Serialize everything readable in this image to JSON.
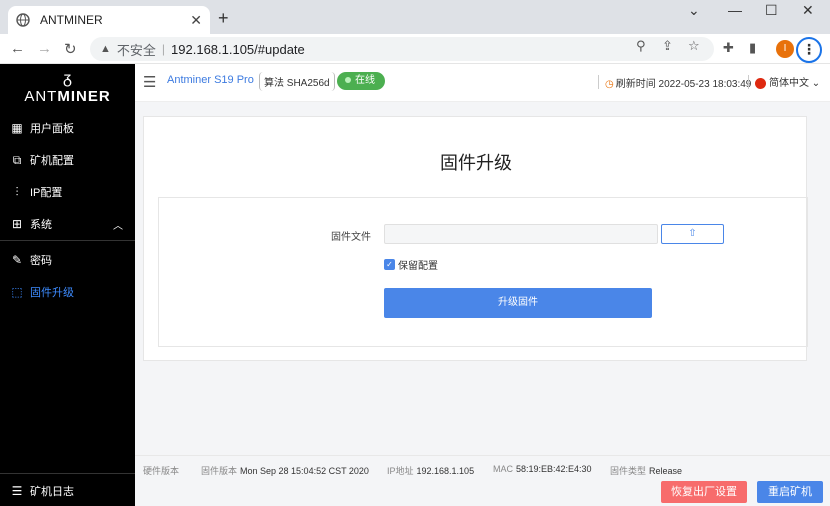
{
  "browser": {
    "tab_title": "ANTMINER",
    "new_tab_glyph": "+",
    "omnibox_security_label": "不安全",
    "url": "192.168.1.105/#update",
    "profile_initial": "I"
  },
  "sidebar": {
    "brand_left": "ANT",
    "brand_right": "MINER",
    "items": [
      {
        "label": "用户面板",
        "icon": "dashboard-icon"
      },
      {
        "label": "矿机配置",
        "icon": "config-icon"
      },
      {
        "label": "IP配置",
        "icon": "sliders-icon"
      },
      {
        "label": "系统",
        "icon": "system-icon"
      },
      {
        "label": "密码",
        "icon": "password-icon"
      },
      {
        "label": "固件升级",
        "icon": "chip-icon"
      }
    ],
    "log_label": "矿机日志"
  },
  "header": {
    "model": "Antminer S19 Pro",
    "algo_label": "算法",
    "algo_value": "SHA256d",
    "status": "在线",
    "refresh_label": "刷新时间",
    "refresh_time": "2022-05-23 18:03:49",
    "language": "简体中文"
  },
  "main": {
    "title": "固件升级",
    "file_label": "固件文件",
    "keep_config_label": "保留配置",
    "keep_config_checked": true,
    "upgrade_button": "升级固件"
  },
  "footer": {
    "hw_label": "硬件版本",
    "hw_value": "",
    "fw_label": "固件版本",
    "fw_value": "Mon Sep 28 15:04:52 CST 2020",
    "ip_label": "IP地址",
    "ip_value": "192.168.1.105",
    "mac_label": "MAC",
    "mac_value": "58:19:EB:42:E4:30",
    "fwtype_label": "固件类型",
    "fwtype_value": "Release",
    "reset_button": "恢复出厂设置",
    "reboot_button": "重启矿机"
  },
  "colors": {
    "accent": "#4a86e8",
    "danger": "#f76c6c",
    "online": "#4caf50",
    "sidebar_bg": "#000000"
  }
}
